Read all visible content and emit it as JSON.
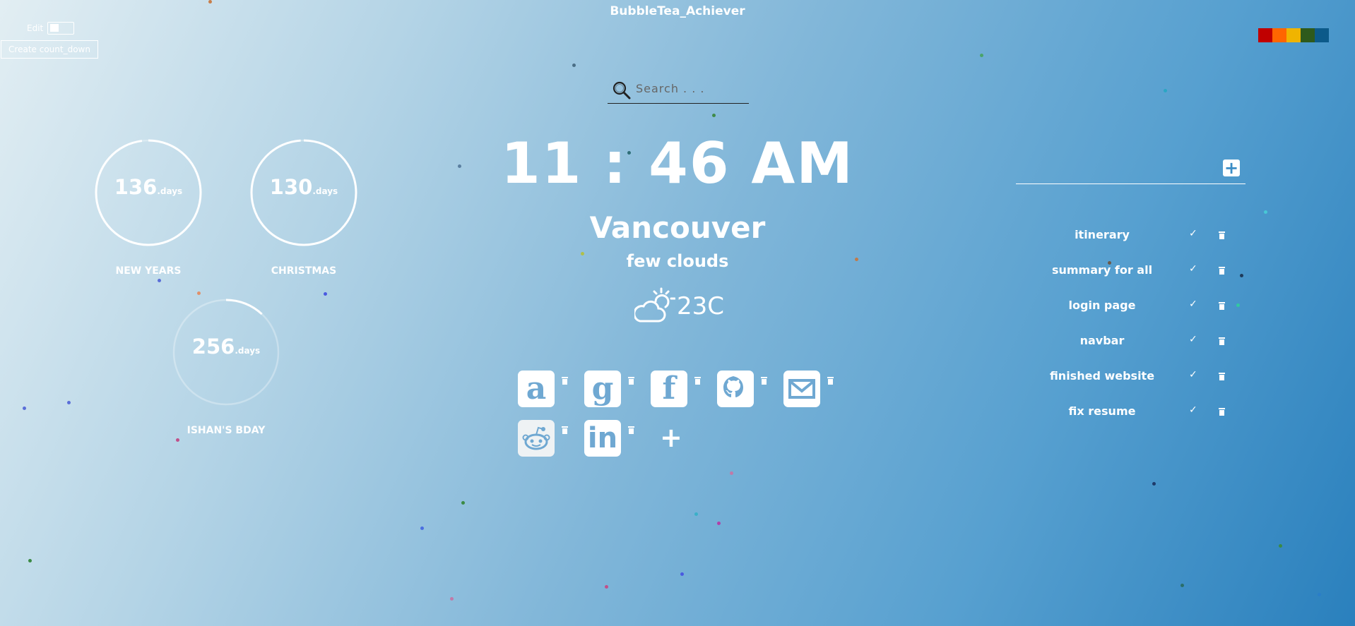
{
  "app": {
    "title": "BubbleTea_Achiever"
  },
  "controls": {
    "edit_label": "Edit",
    "create_countdown_label": "Create count_down",
    "palette": [
      "#c00000",
      "#ff6600",
      "#f0b400",
      "#2e5a1c",
      "#0c5a8a"
    ]
  },
  "search": {
    "placeholder": "Search . . ."
  },
  "clock": {
    "time": "11 : 46 AM"
  },
  "weather": {
    "city": "Vancouver",
    "description": "few clouds",
    "temperature": "23C",
    "icon": "partly-cloudy-icon"
  },
  "countdowns": [
    {
      "value": "136",
      "unit": "days",
      "label": "NEW YEARS",
      "progress": 0.98
    },
    {
      "value": "130",
      "unit": "days",
      "label": "CHRISTMAS",
      "progress": 0.99
    },
    {
      "value": "256",
      "unit": "days",
      "label": "ISHAN'S BDAY",
      "progress": 0.12
    }
  ],
  "links": [
    {
      "name": "amazon",
      "glyph": "a"
    },
    {
      "name": "google",
      "glyph": "g"
    },
    {
      "name": "facebook",
      "glyph": "f"
    },
    {
      "name": "github",
      "glyph": ""
    },
    {
      "name": "mail",
      "glyph": ""
    },
    {
      "name": "reddit",
      "glyph": ""
    },
    {
      "name": "linkedin",
      "glyph": "in"
    }
  ],
  "add_link_label": "+",
  "todos": [
    {
      "text": "itinerary"
    },
    {
      "text": "summary for all"
    },
    {
      "text": "login page"
    },
    {
      "text": "navbar"
    },
    {
      "text": "finished website"
    },
    {
      "text": "fix resume"
    }
  ],
  "todo_add_label": "+"
}
